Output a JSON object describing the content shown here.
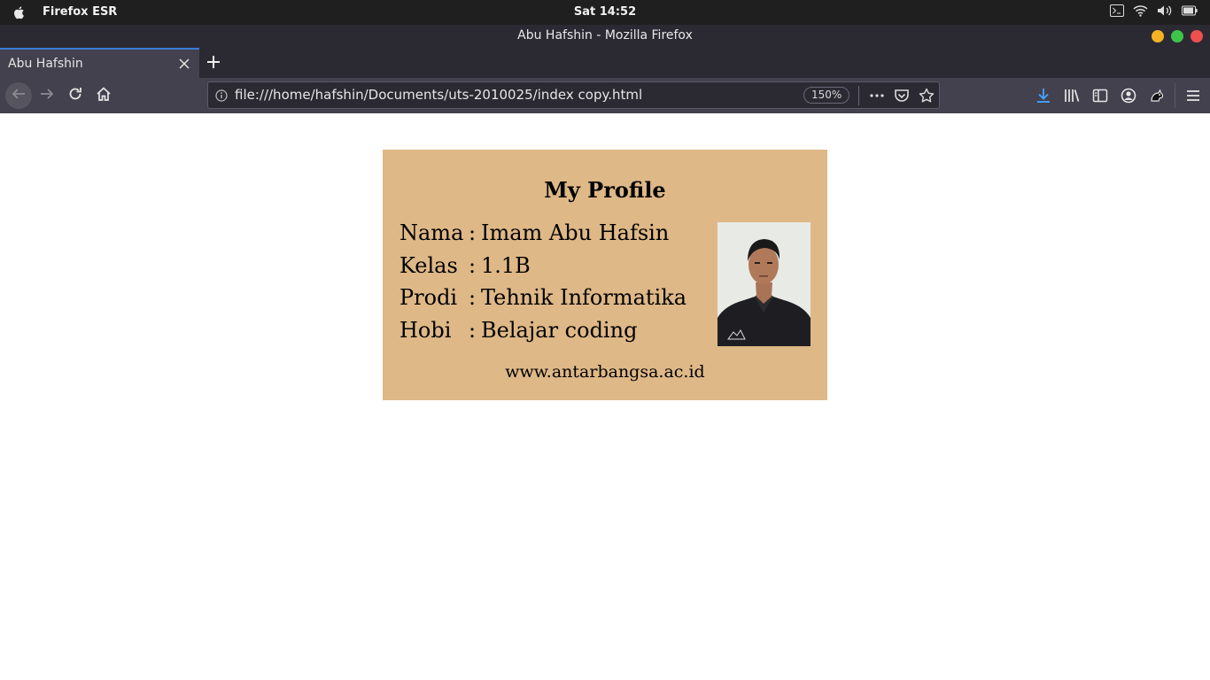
{
  "system_bar": {
    "app_name": "Firefox ESR",
    "clock": "Sat 14:52"
  },
  "window": {
    "title": "Abu Hafshin - Mozilla Firefox"
  },
  "tabs": [
    {
      "label": "Abu Hafshin",
      "active": true
    }
  ],
  "navigation": {
    "url": "file:///home/hafshin/Documents/uts-2010025/index copy.html",
    "zoom": "150%"
  },
  "page": {
    "card_title": "My Profile",
    "rows": [
      {
        "label": "Nama",
        "colon": ":",
        "value": "Imam Abu Hafsin"
      },
      {
        "label": "Kelas",
        "colon": ":",
        "value": "1.1B"
      },
      {
        "label": "Prodi",
        "colon": ":",
        "value": "Tehnik Informatika"
      },
      {
        "label": "Hobi",
        "colon": ":",
        "value": "Belajar coding"
      }
    ],
    "footer": "www.antarbangsa.ac.id",
    "card_color": "#deb887"
  },
  "icons": {
    "system": [
      "apple-icon",
      "terminal-icon",
      "wifi-icon",
      "volume-icon",
      "battery-icon"
    ],
    "nav": [
      "back-icon",
      "forward-icon",
      "reload-icon",
      "home-icon"
    ],
    "toolbar": [
      "download-icon",
      "library-icon",
      "sidebar-icon",
      "account-icon",
      "extension-icon",
      "menu-icon"
    ]
  },
  "colors": {
    "accent": "#3a7bd5",
    "download_accent": "#45a1ff"
  }
}
